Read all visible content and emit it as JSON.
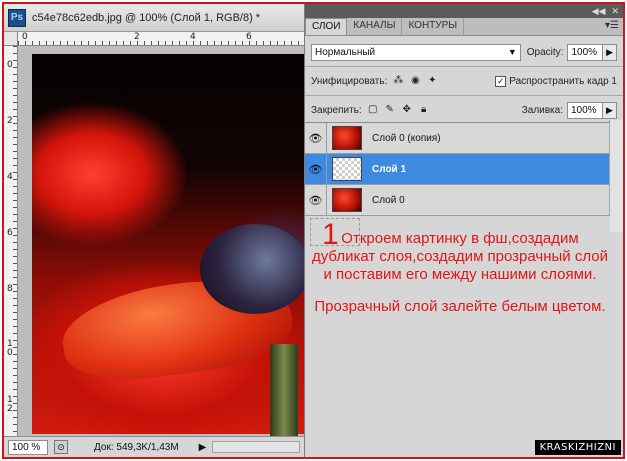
{
  "document": {
    "app_icon_text": "Ps",
    "title": "c54e78c62edb.jpg @ 100% (Слой 1, RGB/8) *",
    "ruler_top_labels": [
      "0",
      "2",
      "4",
      "6"
    ],
    "ruler_left_labels": [
      "0",
      "2",
      "4",
      "6",
      "8",
      "1\n0",
      "1\n2"
    ],
    "zoom": "100 %",
    "doc_info": "Док: 549,3K/1,43M"
  },
  "panel": {
    "tabs": [
      "СЛОИ",
      "КАНАЛЫ",
      "КОНТУРЫ"
    ],
    "blend_mode": "Нормальный",
    "opacity_label": "Opacity:",
    "opacity_value": "100%",
    "unify_label": "Унифицировать:",
    "propagate_label": "Распространить кадр 1",
    "propagate_checked": true,
    "lock_label": "Закрепить:",
    "fill_label": "Заливка:",
    "fill_value": "100%",
    "layers": [
      {
        "name": "Слой 0 (копия)",
        "thumb": "photo",
        "selected": false
      },
      {
        "name": "Слой 1",
        "thumb": "transparent",
        "selected": true
      },
      {
        "name": "Слой 0",
        "thumb": "photo",
        "selected": false
      }
    ]
  },
  "instructions": {
    "step_number": "1",
    "paragraph1": "Откроем картинку в фш,создадим дубликат слоя,создадим прозрачный слой и поставим его между нашими слоями.",
    "paragraph2": "Прозрачный слой залейте белым цветом."
  },
  "watermark": "KRASKIZHIZNI",
  "colors": {
    "frame_border": "#c61a1a",
    "instruction_text": "#e01616",
    "selected_layer": "#3e8ae0"
  }
}
